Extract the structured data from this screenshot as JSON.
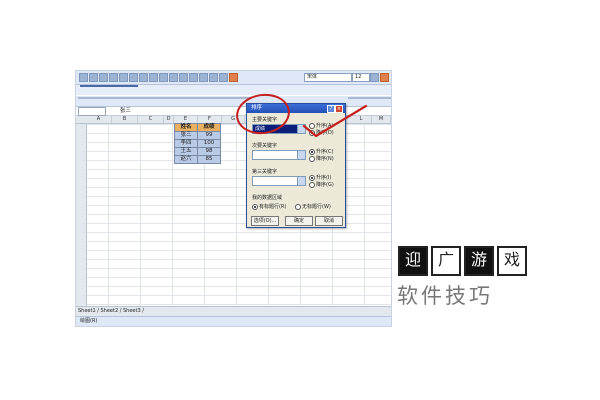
{
  "formula_bar": {
    "cell_value": "张三"
  },
  "toolbar": {
    "font_name": "宋体",
    "font_size": "12"
  },
  "columns": [
    "A",
    "B",
    "C",
    "D",
    "E",
    "F",
    "G",
    "H",
    "I",
    "J",
    "K",
    "L",
    "M",
    "N",
    "O",
    "P",
    "Q"
  ],
  "table": {
    "headers": [
      "姓名",
      "成绩"
    ],
    "rows": [
      [
        "张三",
        "99"
      ],
      [
        "李四",
        "100"
      ],
      [
        "王五",
        "98"
      ],
      [
        "赵六",
        "85"
      ]
    ]
  },
  "dialog": {
    "title": "排序",
    "primary_key_label": "主要关键字",
    "primary_key_value": "成绩",
    "secondary_key_label": "次要关键字",
    "tertiary_key_label": "第三关键字",
    "range_label": "我的数据区域",
    "asc_label": "升序(A)",
    "desc_label": "降序(D)",
    "asc_label2": "升序(C)",
    "desc_label2": "降序(N)",
    "asc_label3": "升序(I)",
    "desc_label3": "降序(G)",
    "header_row": "有标题行(R)",
    "no_header_row": "无标题行(W)",
    "options_button": "选项(O)...",
    "ok_button": "确定",
    "cancel_button": "取消"
  },
  "sheet_tabs": "Sheet1 / Sheet2 / Sheet3 /",
  "draw_toolbar": {
    "label": "绘图(R)"
  },
  "watermark": {
    "chars": [
      "迎",
      "广",
      "游",
      "戏"
    ],
    "subtitle": "软件技巧"
  },
  "colors": {
    "annotation": "#c4201f",
    "selected_key": "#0b1e7a",
    "header_fill": "#e8b060",
    "body_fill": "#b9cae6"
  }
}
